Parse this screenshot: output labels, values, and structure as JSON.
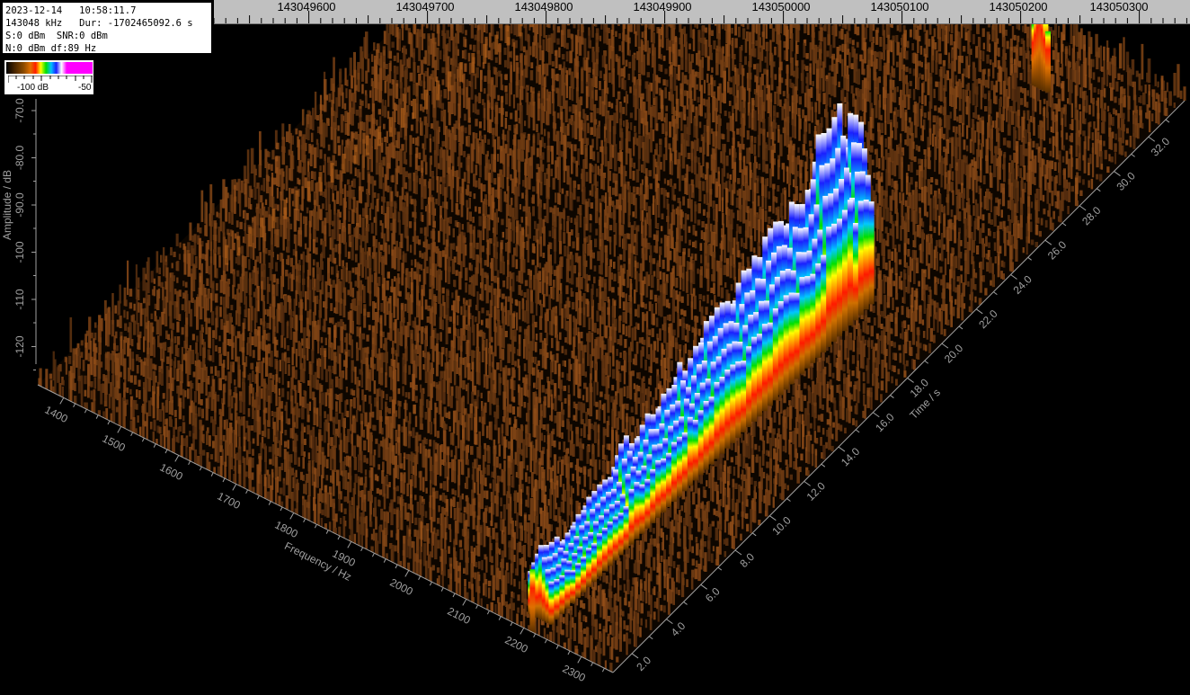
{
  "info": {
    "line1": "2023-12-14   10:58:11.7",
    "line2": "143048 kHz   Dur: -1702465092.6 s",
    "line3": "S:0 dBm  SNR:0 dBm",
    "line4": "N:0 dBm df:89 Hz"
  },
  "legend": {
    "min_label": "-100 dB",
    "max_label": "-50"
  },
  "top_ruler": {
    "labels": [
      "143049600",
      "143049700",
      "143049800",
      "143049900",
      "143050000",
      "143050100",
      "143050200",
      "143050300"
    ]
  },
  "axes": {
    "amplitude": {
      "title": "Amplitude / dB",
      "ticks": [
        "-70.0",
        "-80.0",
        "-90.0",
        "-100",
        "-110",
        "-120"
      ]
    },
    "frequency": {
      "title": "Frequency / Hz",
      "ticks": [
        "1400",
        "1500",
        "1600",
        "1700",
        "1800",
        "1900",
        "2000",
        "2100",
        "2200",
        "2300"
      ]
    },
    "time": {
      "title": "Time / s",
      "ticks": [
        "2.0",
        "4.0",
        "6.0",
        "8.0",
        "10.0",
        "12.0",
        "14.0",
        "16.0",
        "18.0",
        "20.0",
        "22.0",
        "24.0",
        "26.0",
        "28.0",
        "30.0",
        "32.0"
      ]
    }
  },
  "colors": {
    "background": "#000000",
    "noise": "#8a4a14",
    "axis": "#a0a0a0",
    "ruler": "#c0c0c0"
  }
}
